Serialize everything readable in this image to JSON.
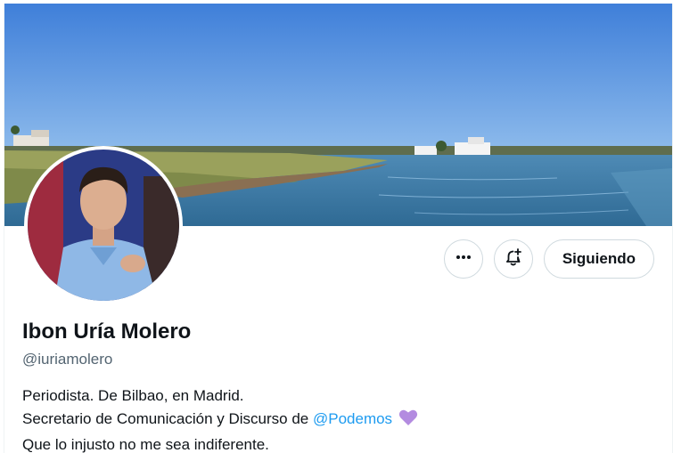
{
  "profile": {
    "name": "Ibon Uría Molero",
    "handle": "@iuriamolero",
    "bio_line1": "Periodista. De Bilbao, en Madrid.",
    "bio_line2_prefix": "Secretario de Comunicación y Discurso de ",
    "bio_mention": "@Podemos",
    "bio_line3": "Que lo injusto no me sea indiferente."
  },
  "actions": {
    "more_icon": "more-horizontal-icon",
    "notify_icon": "bell-plus-icon",
    "follow_label": "Siguiendo"
  },
  "colors": {
    "link": "#1d9bf0",
    "heart": "#b38be0",
    "border": "#cfd9de",
    "secondary_text": "#536471"
  }
}
